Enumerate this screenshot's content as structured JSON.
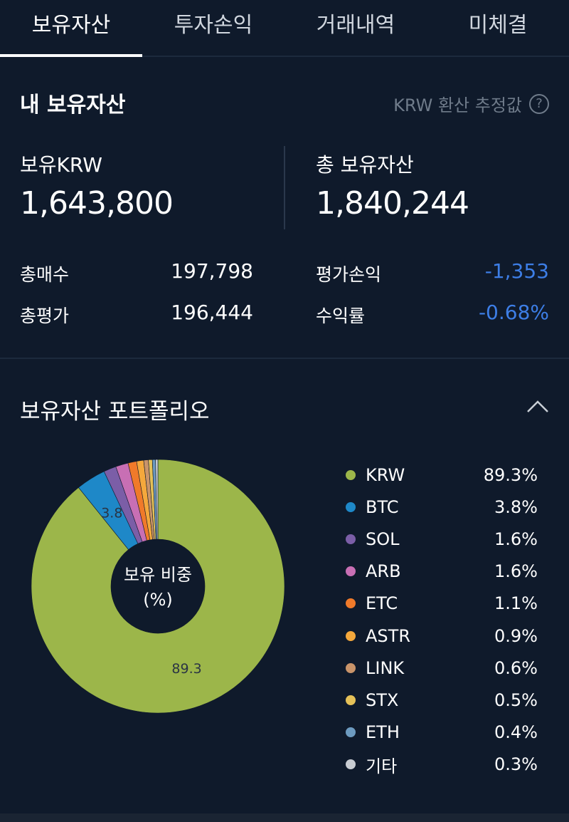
{
  "tabs": [
    {
      "label": "보유자산",
      "active": true
    },
    {
      "label": "투자손익",
      "active": false
    },
    {
      "label": "거래내역",
      "active": false
    },
    {
      "label": "미체결",
      "active": false
    }
  ],
  "summary": {
    "title": "내 보유자산",
    "note": "KRW 환산 추정값",
    "help_icon": "question-circle-icon",
    "krw_label": "보유KRW",
    "krw_value": "1,643,800",
    "total_label": "총 보유자산",
    "total_value": "1,840,244",
    "buy_label": "총매수",
    "buy_value": "197,798",
    "eval_label": "총평가",
    "eval_value": "196,444",
    "pnl_label": "평가손익",
    "pnl_value": "-1,353",
    "rate_label": "수익률",
    "rate_value": "-0.68%",
    "negative_color": "#3d7ee6"
  },
  "portfolio": {
    "title": "보유자산 포트폴리오",
    "collapse_icon": "chevron-up-icon",
    "center_label_1": "보유 비중",
    "center_label_2": "(%)",
    "items": [
      {
        "name": "KRW",
        "pct": "89.3%",
        "value": 89.3,
        "color": "#9cb64a",
        "slice_label": "89.3"
      },
      {
        "name": "BTC",
        "pct": "3.8%",
        "value": 3.8,
        "color": "#1e88c8",
        "slice_label": "3.8"
      },
      {
        "name": "SOL",
        "pct": "1.6%",
        "value": 1.6,
        "color": "#7b5ea7"
      },
      {
        "name": "ARB",
        "pct": "1.6%",
        "value": 1.6,
        "color": "#c86fb4"
      },
      {
        "name": "ETC",
        "pct": "1.1%",
        "value": 1.1,
        "color": "#f07a2a"
      },
      {
        "name": "ASTR",
        "pct": "0.9%",
        "value": 0.9,
        "color": "#f4a83c"
      },
      {
        "name": "LINK",
        "pct": "0.6%",
        "value": 0.6,
        "color": "#c9946a"
      },
      {
        "name": "STX",
        "pct": "0.5%",
        "value": 0.5,
        "color": "#e5c158"
      },
      {
        "name": "ETH",
        "pct": "0.4%",
        "value": 0.4,
        "color": "#6d9bc0"
      },
      {
        "name": "기타",
        "pct": "0.3%",
        "value": 0.3,
        "color": "#c8ccd2"
      }
    ]
  }
}
